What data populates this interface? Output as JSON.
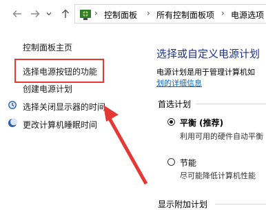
{
  "breadcrumb": {
    "items": [
      "控制面板",
      "所有控制面板项",
      "电源选项"
    ],
    "separator": "›"
  },
  "sidebar": {
    "home_link": "控制面板主页",
    "items": [
      {
        "label": "选择电源按钮的功能",
        "icon": null,
        "highlighted": true
      },
      {
        "label": "创建电源计划",
        "icon": null
      },
      {
        "label": "选择关闭显示器的时间",
        "icon": "monitor-schedule-icon"
      },
      {
        "label": "更改计算机睡眠时间",
        "icon": "moon-icon"
      }
    ]
  },
  "main": {
    "title": "选择或自定义电源计划",
    "description": "电源计划是用于管理计算机如",
    "more_link": "划的详细信息",
    "preferred_plans_label": "首选计划",
    "plans": [
      {
        "name": "平衡 (推荐)",
        "desc": "利用可用的硬件自动平衡",
        "selected": true
      },
      {
        "name": "节能",
        "desc": "尽可能降低计算机性能",
        "selected": false
      }
    ],
    "additional_plans_label": "显示附加计划"
  },
  "colors": {
    "highlight_box": "#e53935",
    "title_blue": "#1e3287",
    "link_blue": "#0066cc"
  }
}
